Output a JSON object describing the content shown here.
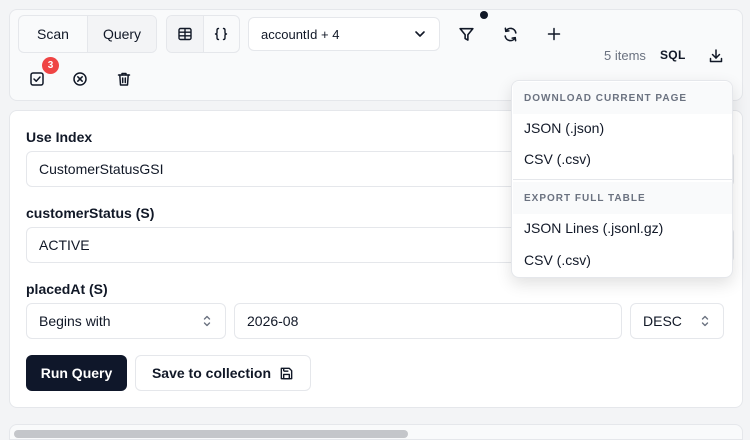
{
  "toolbar": {
    "mode_tabs": [
      {
        "label": "Scan",
        "active": false
      },
      {
        "label": "Query",
        "active": true
      }
    ],
    "view_buttons": [
      {
        "icon": "table-icon",
        "active": true
      },
      {
        "icon": "braces-icon",
        "active": false
      }
    ],
    "attribute_select": {
      "value": "accountId + 4"
    },
    "icons": [
      "filter-icon",
      "refresh-icon",
      "plus-icon",
      "download-icon",
      "checkbox-icon",
      "circle-x-icon",
      "trash-icon"
    ],
    "items_count": "5 items",
    "sql_label": "SQL",
    "selection_badge": "3"
  },
  "query": {
    "index_label": "Use Index",
    "index_value": "CustomerStatusGSI",
    "pk_label": "customerStatus (S)",
    "pk_value": "ACTIVE",
    "sk_label": "placedAt (S)",
    "sk_operator": "Begins with",
    "sk_value": "2026-08",
    "sort_order": "DESC",
    "run_label": "Run Query",
    "save_label": "Save to collection"
  },
  "download_menu": {
    "section_current": "DOWNLOAD CURRENT PAGE",
    "current_items": [
      "JSON (.json)",
      "CSV (.csv)"
    ],
    "section_full": "EXPORT FULL TABLE",
    "full_items": [
      "JSON Lines (.jsonl.gz)",
      "CSV (.csv)"
    ]
  },
  "colors": {
    "primary": "#0f172a",
    "badge": "#ef4444",
    "border": "#e5e7eb",
    "muted_text": "#6b7280"
  }
}
